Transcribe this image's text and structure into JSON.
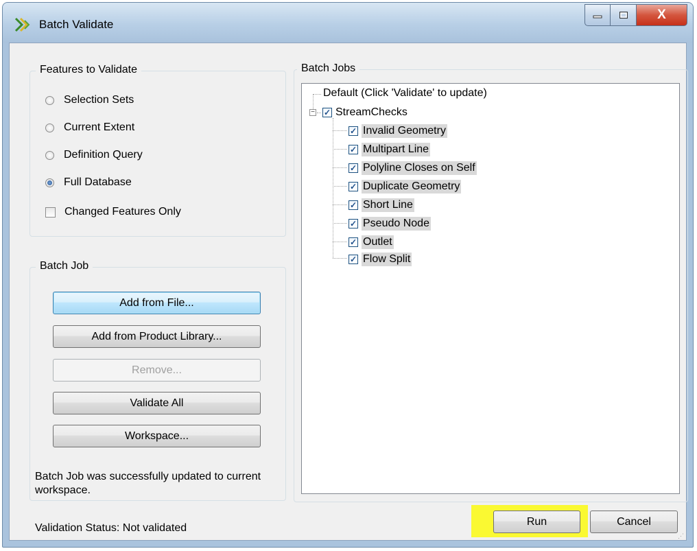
{
  "window": {
    "title": "Batch Validate",
    "close_glyph": "X",
    "app_icon": "arcgis-validate-icon"
  },
  "features_group": {
    "legend": "Features to Validate",
    "options": [
      {
        "label": "Selection Sets",
        "checked": false
      },
      {
        "label": "Current Extent",
        "checked": false
      },
      {
        "label": "Definition Query",
        "checked": false
      },
      {
        "label": "Full Database",
        "checked": true
      }
    ],
    "changed_only_label": "Changed Features Only"
  },
  "batch_job_group": {
    "legend": "Batch Job",
    "add_from_file": "Add from File...",
    "add_from_library": "Add from Product Library...",
    "remove": "Remove...",
    "validate_all": "Validate All",
    "workspace": "Workspace...",
    "status_message": "Batch Job was successfully updated to current workspace."
  },
  "batch_jobs": {
    "legend": "Batch Jobs",
    "default_node": "Default (Click 'Validate' to update)",
    "parent_node": "StreamChecks",
    "check_glyph": "✓",
    "expander_glyph": "−",
    "children": [
      "Invalid Geometry",
      "Multipart Line",
      "Polyline Closes on Self",
      "Duplicate Geometry",
      "Short Line",
      "Pseudo Node",
      "Outlet",
      "Flow Split"
    ]
  },
  "footer": {
    "validation_status": "Validation Status: Not validated",
    "run": "Run",
    "cancel": "Cancel",
    "highlight_color": "#faf932"
  }
}
